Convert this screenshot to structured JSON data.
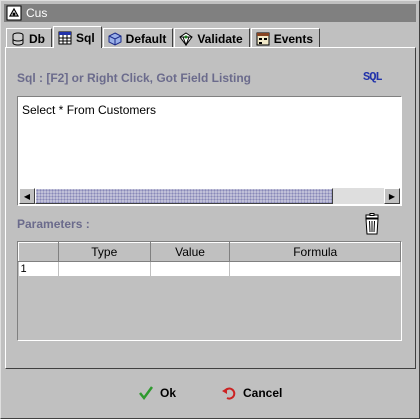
{
  "window": {
    "title": "Cus"
  },
  "tabs": [
    {
      "label": "Db",
      "icon": "database-icon",
      "active": false
    },
    {
      "label": "Sql",
      "icon": "sql-table-icon",
      "active": true
    },
    {
      "label": "Default",
      "icon": "cube-icon",
      "active": false
    },
    {
      "label": "Validate",
      "icon": "validate-icon",
      "active": false
    },
    {
      "label": "Events",
      "icon": "events-icon",
      "active": false
    }
  ],
  "sql": {
    "hint_label": "Sql : [F2] or Right Click, Got Field Listing",
    "sql_button_label": "SQL",
    "query_text": "Select * From Customers"
  },
  "parameters": {
    "label": "Parameters :",
    "columns": [
      "",
      "Type",
      "Value",
      "Formula"
    ],
    "rows": [
      [
        "1",
        "",
        "",
        ""
      ]
    ]
  },
  "footer": {
    "ok_label": "Ok",
    "cancel_label": "Cancel"
  },
  "colors": {
    "label_color": "#6b6b8c",
    "title_bar": "#808080",
    "ok_check": "#2e9a2e",
    "cancel_arrow": "#cc2222"
  }
}
